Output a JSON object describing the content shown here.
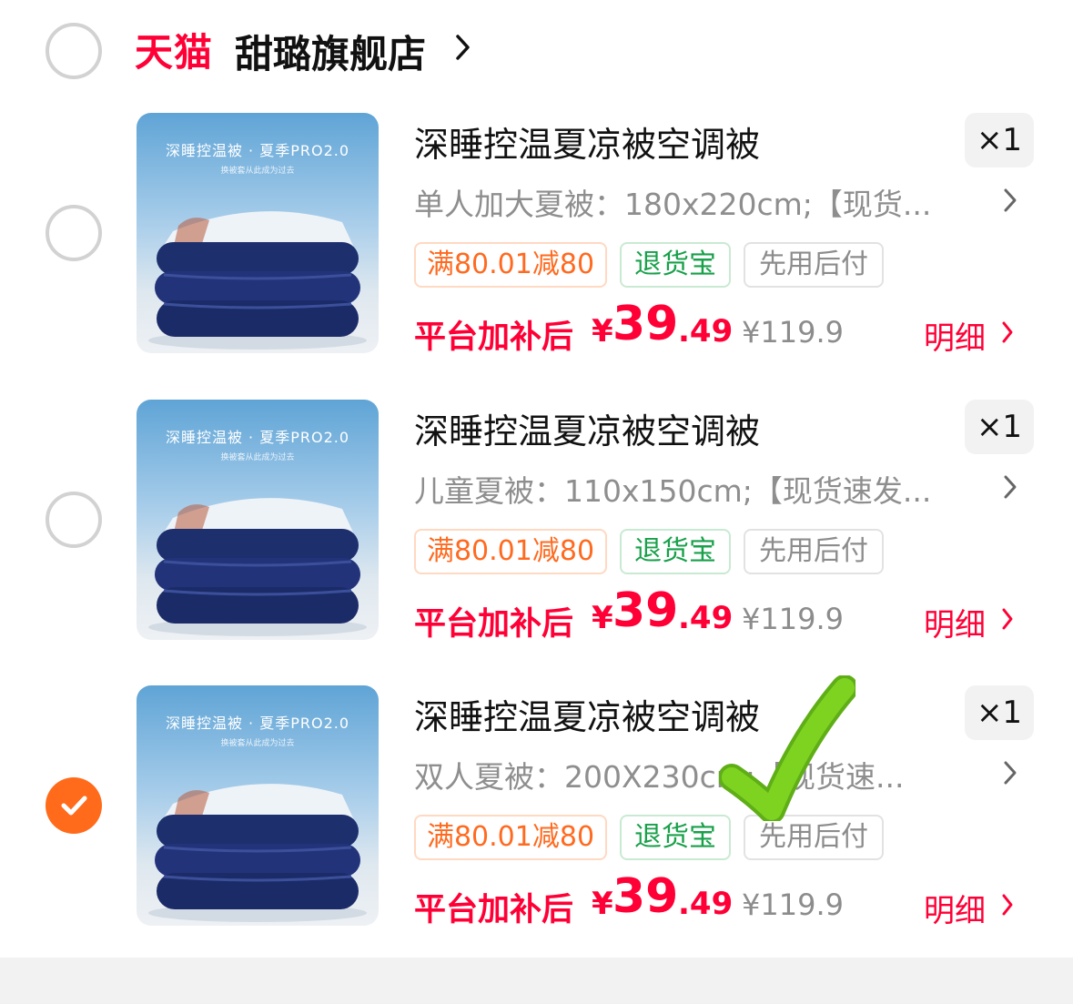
{
  "store": {
    "platform": "天猫",
    "name": "甜璐旗舰店",
    "selected": false
  },
  "items": [
    {
      "selected": false,
      "image_title": "深睡控温被 · 夏季PRO2.0",
      "image_subtitle": "换被套从此成为过去",
      "title": "深睡控温夏凉被空调被",
      "quantity": "×1",
      "spec": "单人加大夏被：180x220cm;【现货...",
      "tags": {
        "promo": "满80.01减80",
        "returns": "退货宝",
        "paylater": "先用后付"
      },
      "price_label": "平台加补后",
      "price_currency": "¥",
      "price_int": "39",
      "price_dec": ".49",
      "original_price": "¥119.9",
      "detail_label": "明细"
    },
    {
      "selected": false,
      "image_title": "深睡控温被 · 夏季PRO2.0",
      "image_subtitle": "换被套从此成为过去",
      "title": "深睡控温夏凉被空调被",
      "quantity": "×1",
      "spec": "儿童夏被：110x150cm;【现货速发...",
      "tags": {
        "promo": "满80.01减80",
        "returns": "退货宝",
        "paylater": "先用后付"
      },
      "price_label": "平台加补后",
      "price_currency": "¥",
      "price_int": "39",
      "price_dec": ".49",
      "original_price": "¥119.9",
      "detail_label": "明细"
    },
    {
      "selected": true,
      "image_title": "深睡控温被 · 夏季PRO2.0",
      "image_subtitle": "换被套从此成为过去",
      "title": "深睡控温夏凉被空调被",
      "quantity": "×1",
      "spec": "双人夏被：200X230cm;【现货速...",
      "tags": {
        "promo": "满80.01减80",
        "returns": "退货宝",
        "paylater": "先用后付"
      },
      "price_label": "平台加补后",
      "price_currency": "¥",
      "price_int": "39",
      "price_dec": ".49",
      "original_price": "¥119.9",
      "detail_label": "明细"
    }
  ],
  "colors": {
    "accent_red": "#ff0036",
    "check_orange": "#ff6b1a",
    "promo_orange": "#ff6a1f",
    "returns_green": "#18a04a",
    "annotation_green": "#7ed321"
  }
}
